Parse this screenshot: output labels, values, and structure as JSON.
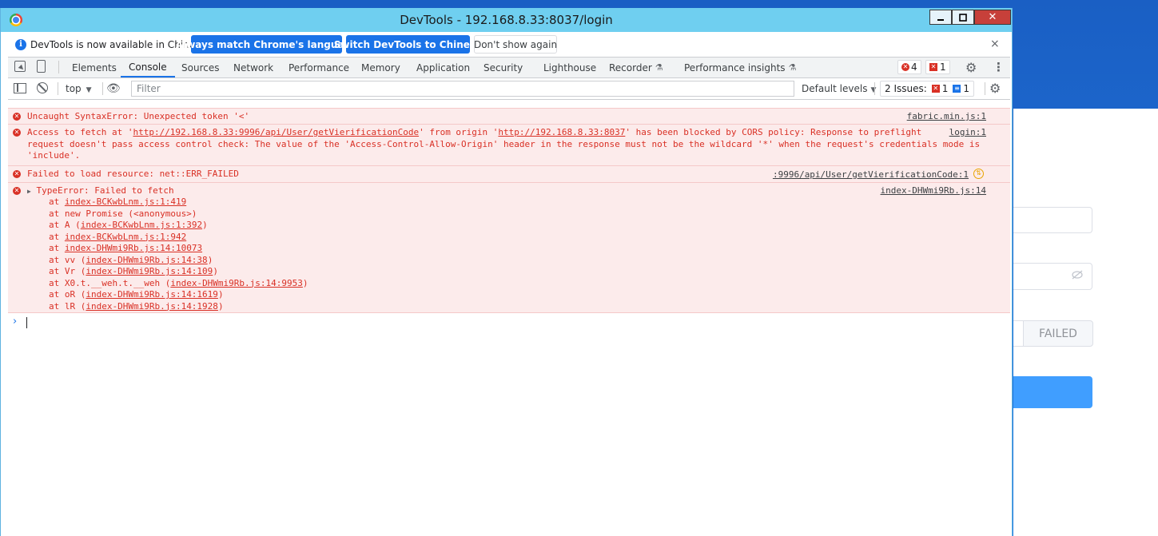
{
  "window": {
    "title": "DevTools - 192.168.8.33:8037/login"
  },
  "infobar": {
    "text": "DevTools is now available in Chinese!",
    "match_button": "Always match Chrome's language",
    "switch_button": "Switch DevTools to Chinese",
    "dismiss_button": "Don't show again",
    "close": "×"
  },
  "tabs": [
    {
      "label": "Elements"
    },
    {
      "label": "Console"
    },
    {
      "label": "Sources"
    },
    {
      "label": "Network"
    },
    {
      "label": "Performance"
    },
    {
      "label": "Memory"
    },
    {
      "label": "Application"
    },
    {
      "label": "Security"
    },
    {
      "label": "Lighthouse"
    },
    {
      "label": "Recorder"
    },
    {
      "label": "Performance insights"
    }
  ],
  "counts": {
    "errors": "4",
    "issues_badge": "1"
  },
  "toolbar": {
    "context": "top",
    "filter_placeholder": "Filter",
    "levels": "Default levels",
    "issues_label": "2 Issues:",
    "issues_errors": "1",
    "issues_info": "1"
  },
  "messages": [
    {
      "text": "Uncaught SyntaxError: Unexpected token '<'",
      "source": "fabric.min.js:1"
    },
    {
      "pre1": "Access to fetch at '",
      "link1": "http://192.168.8.33:9996/api/User/getVierificationCode",
      "mid": "' from origin '",
      "link2": "http://192.168.8.33:8037",
      "post": "' has been blocked by CORS policy: Response to preflight",
      "line2": "request doesn't pass access control check: The value of the 'Access-Control-Allow-Origin' header in the response must not be the wildcard '*' when the request's credentials mode is",
      "line3": "'include'.",
      "source": "login:1"
    },
    {
      "text": "Failed to load resource: net::ERR_FAILED",
      "source": ":9996/api/User/getVierificationCode:1"
    },
    {
      "text": "TypeError: Failed to fetch",
      "source": "index-DHWmi9Rb.js:14",
      "stack": [
        {
          "pre": "at ",
          "link": "index-BCKwbLnm.js:1:419",
          "post": ""
        },
        {
          "pre": "at new Promise (<anonymous>)",
          "link": "",
          "post": ""
        },
        {
          "pre": "at A (",
          "link": "index-BCKwbLnm.js:1:392",
          "post": ")"
        },
        {
          "pre": "at ",
          "link": "index-BCKwbLnm.js:1:942",
          "post": ""
        },
        {
          "pre": "at ",
          "link": "index-DHWmi9Rb.js:14:10073",
          "post": ""
        },
        {
          "pre": "at vv (",
          "link": "index-DHWmi9Rb.js:14:38",
          "post": ")"
        },
        {
          "pre": "at Vr (",
          "link": "index-DHWmi9Rb.js:14:109",
          "post": ")"
        },
        {
          "pre": "at X0.t.__weh.t.__weh (",
          "link": "index-DHWmi9Rb.js:14:9953",
          "post": ")"
        },
        {
          "pre": "at oR (",
          "link": "index-DHWmi9Rb.js:14:1619",
          "post": ")"
        },
        {
          "pre": "at lR (",
          "link": "index-DHWmi9Rb.js:14:1928",
          "post": ")"
        }
      ]
    }
  ],
  "background_page": {
    "failed_button": "FAILED"
  }
}
